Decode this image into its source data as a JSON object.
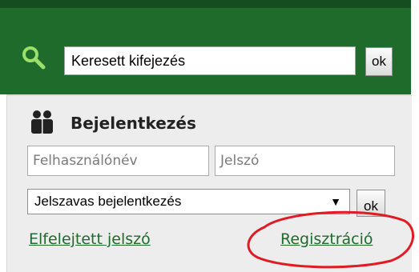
{
  "search": {
    "value": "Keresett kifejezés",
    "button_label": "ok"
  },
  "login": {
    "title": "Bejelentkezés",
    "username_placeholder": "Felhasználónév",
    "password_placeholder": "Jelszó",
    "method_selected": "Jelszavas bejelentkezés",
    "submit_label": "ok",
    "forgot_password_link": "Elfelejtett jelszó",
    "register_link": "Regisztráció"
  },
  "colors": {
    "header_green": "#1f6b2c",
    "link_green": "#1f6b2c",
    "annotation_red": "#e01b24"
  },
  "icons": {
    "search": "magnifier-icon",
    "login": "users-icon",
    "dropdown": "triangle-down-icon"
  }
}
